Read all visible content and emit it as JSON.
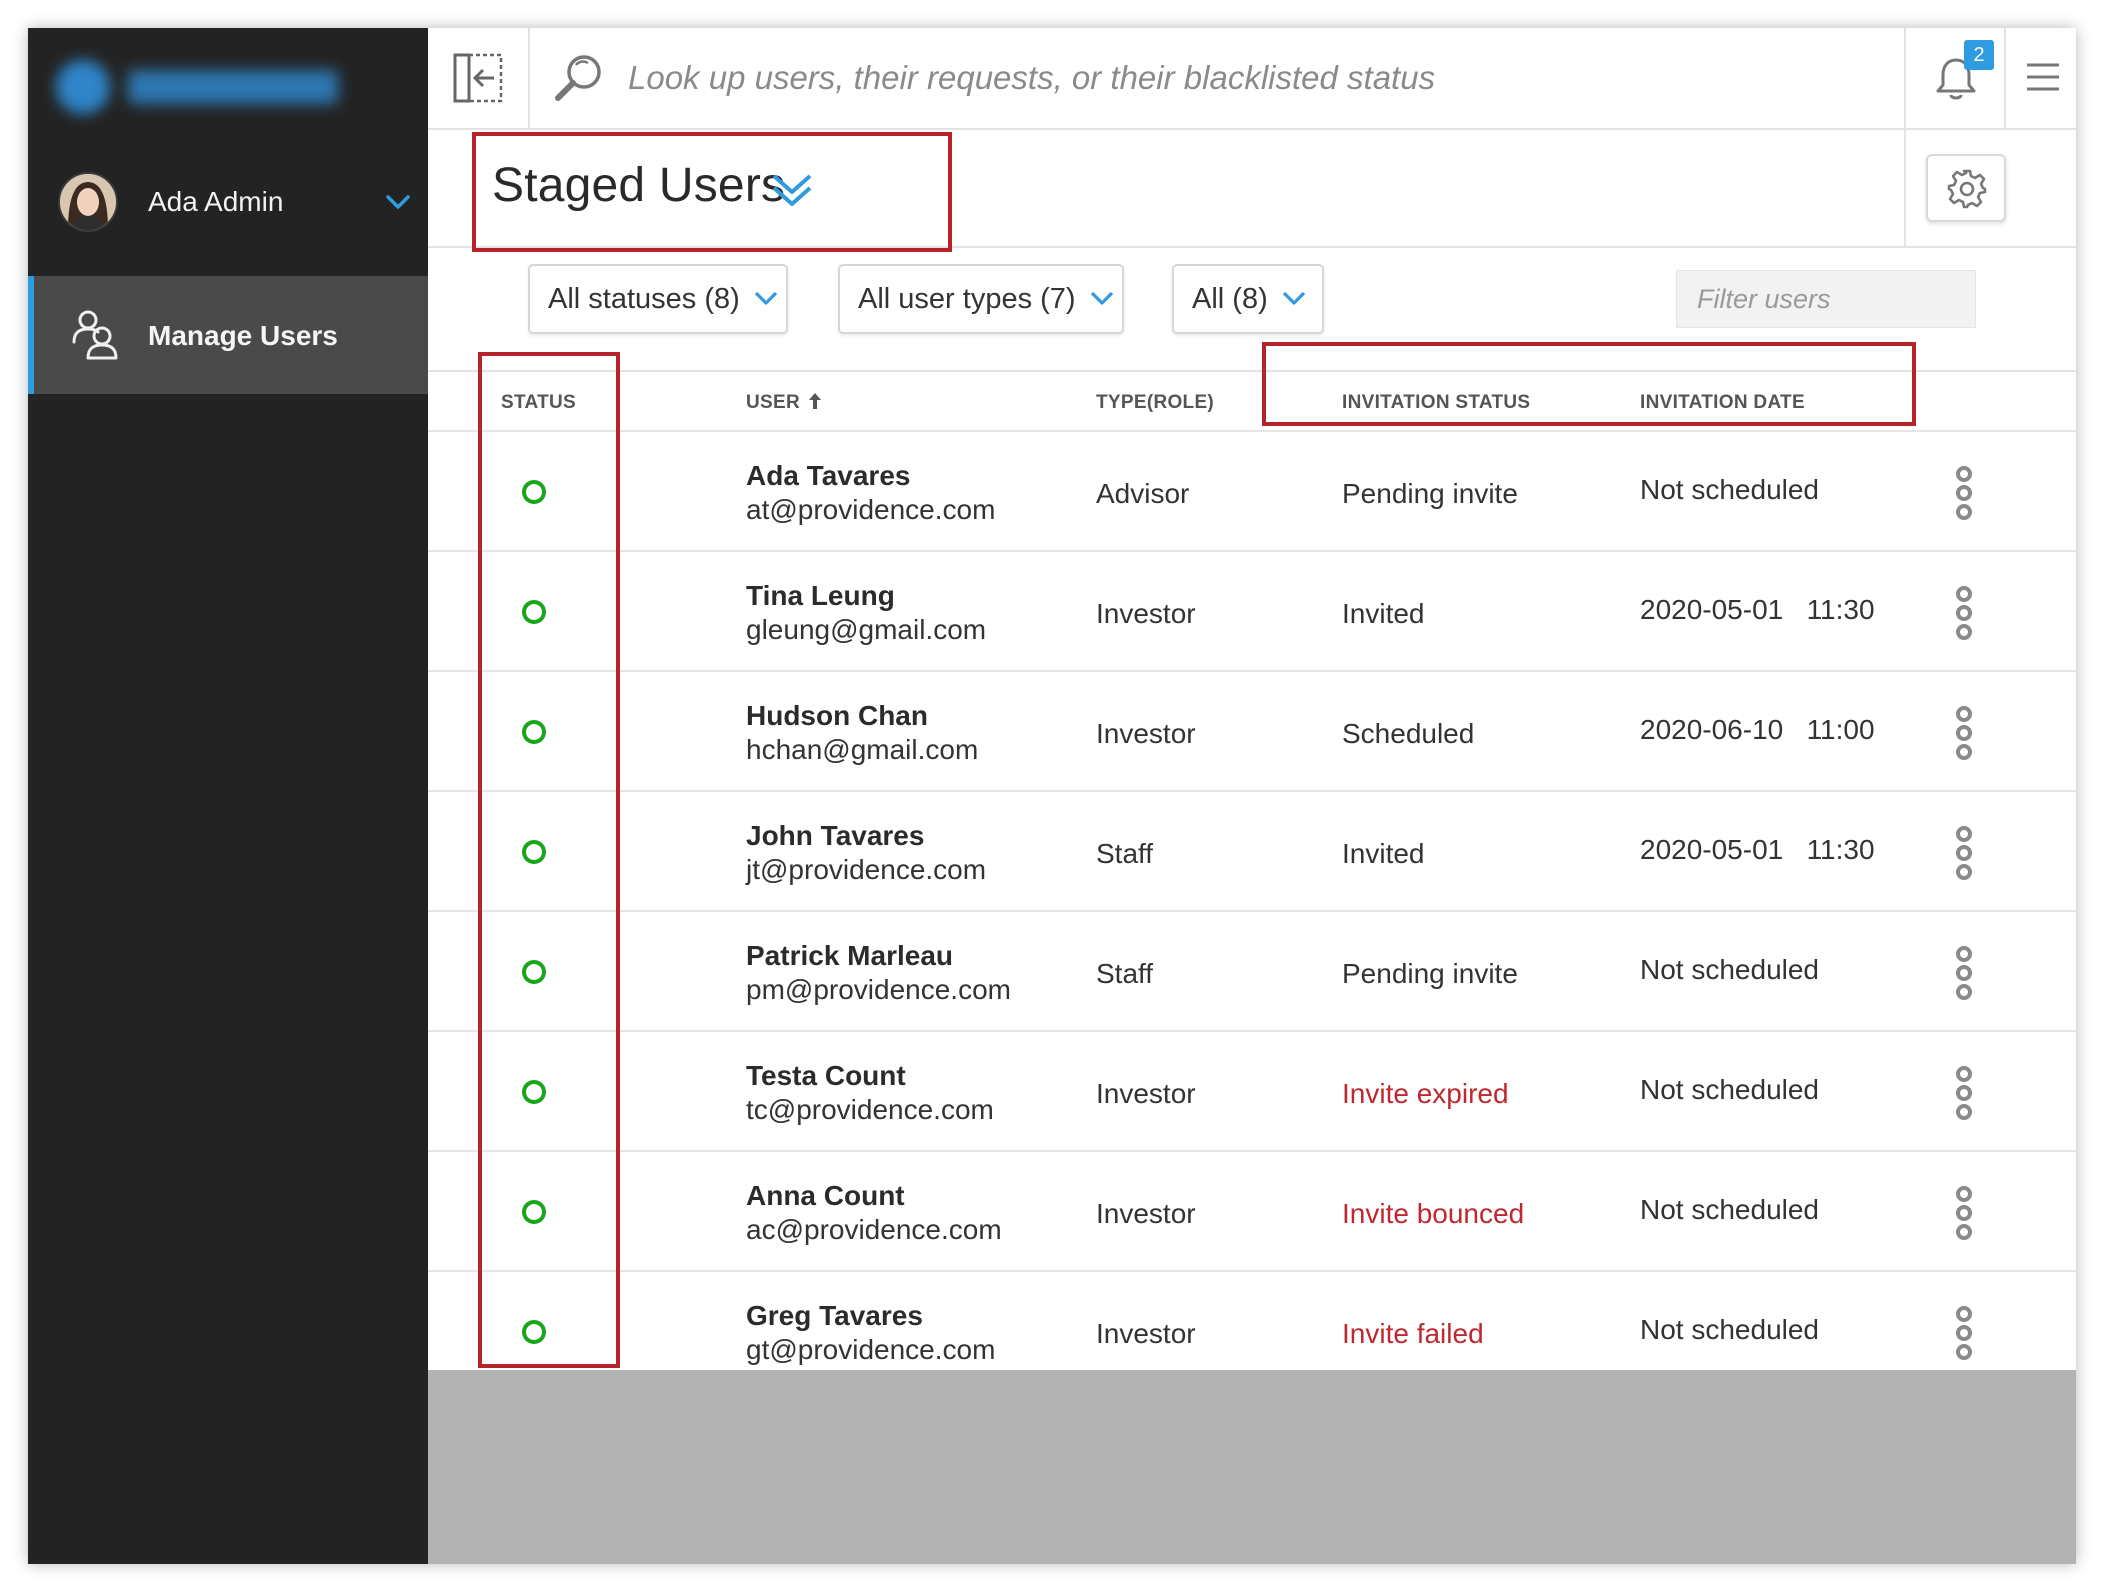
{
  "brand": {
    "logo_text": "Pierisight"
  },
  "sidebar": {
    "user": {
      "name": "Ada Admin"
    },
    "items": [
      {
        "label": "Manage Users",
        "icon": "users-icon",
        "active": true
      }
    ]
  },
  "topbar": {
    "search": {
      "placeholder": "Look up users, their requests, or their blacklisted status"
    },
    "notifications": {
      "count": "2"
    }
  },
  "page": {
    "title": "Staged Users"
  },
  "filters": {
    "statuses": "All statuses (8)",
    "user_types": "All user types (7)",
    "all": "All (8)",
    "search_placeholder": "Filter users"
  },
  "table": {
    "columns": {
      "status": "STATUS",
      "user": "USER",
      "type": "TYPE(ROLE)",
      "invitation_status": "INVITATION STATUS",
      "invitation_date": "INVITATION DATE"
    },
    "rows": [
      {
        "name": "Ada Tavares",
        "email": "at@providence.com",
        "type": "Advisor",
        "invitation_status": "Pending invite",
        "invitation_date": "Not scheduled",
        "error": false
      },
      {
        "name": "Tina Leung",
        "email": "gleung@gmail.com",
        "type": "Investor",
        "invitation_status": "Invited",
        "invitation_date": "2020-05-01   11:30",
        "error": false
      },
      {
        "name": "Hudson Chan",
        "email": "hchan@gmail.com",
        "type": "Investor",
        "invitation_status": "Scheduled",
        "invitation_date": "2020-06-10   11:00",
        "error": false
      },
      {
        "name": "John Tavares",
        "email": "jt@providence.com",
        "type": "Staff",
        "invitation_status": "Invited",
        "invitation_date": "2020-05-01   11:30",
        "error": false
      },
      {
        "name": "Patrick Marleau",
        "email": "pm@providence.com",
        "type": "Staff",
        "invitation_status": "Pending invite",
        "invitation_date": "Not scheduled",
        "error": false
      },
      {
        "name": "Testa Count",
        "email": "tc@providence.com",
        "type": "Investor",
        "invitation_status": "Invite expired",
        "invitation_date": "Not scheduled",
        "error": true
      },
      {
        "name": "Anna Count",
        "email": "ac@providence.com",
        "type": "Investor",
        "invitation_status": "Invite bounced",
        "invitation_date": "Not scheduled",
        "error": true
      },
      {
        "name": "Greg Tavares",
        "email": "gt@providence.com",
        "type": "Investor",
        "invitation_status": "Invite failed",
        "invitation_date": "Not scheduled",
        "error": true
      }
    ]
  },
  "colors": {
    "sidebar_bg": "#232323",
    "active_nav_bg": "#4a4a4a",
    "accent_blue": "#2f9be0",
    "status_green": "#1aa51a",
    "error_red": "#c0282f",
    "annotation_red": "#b5242b"
  }
}
